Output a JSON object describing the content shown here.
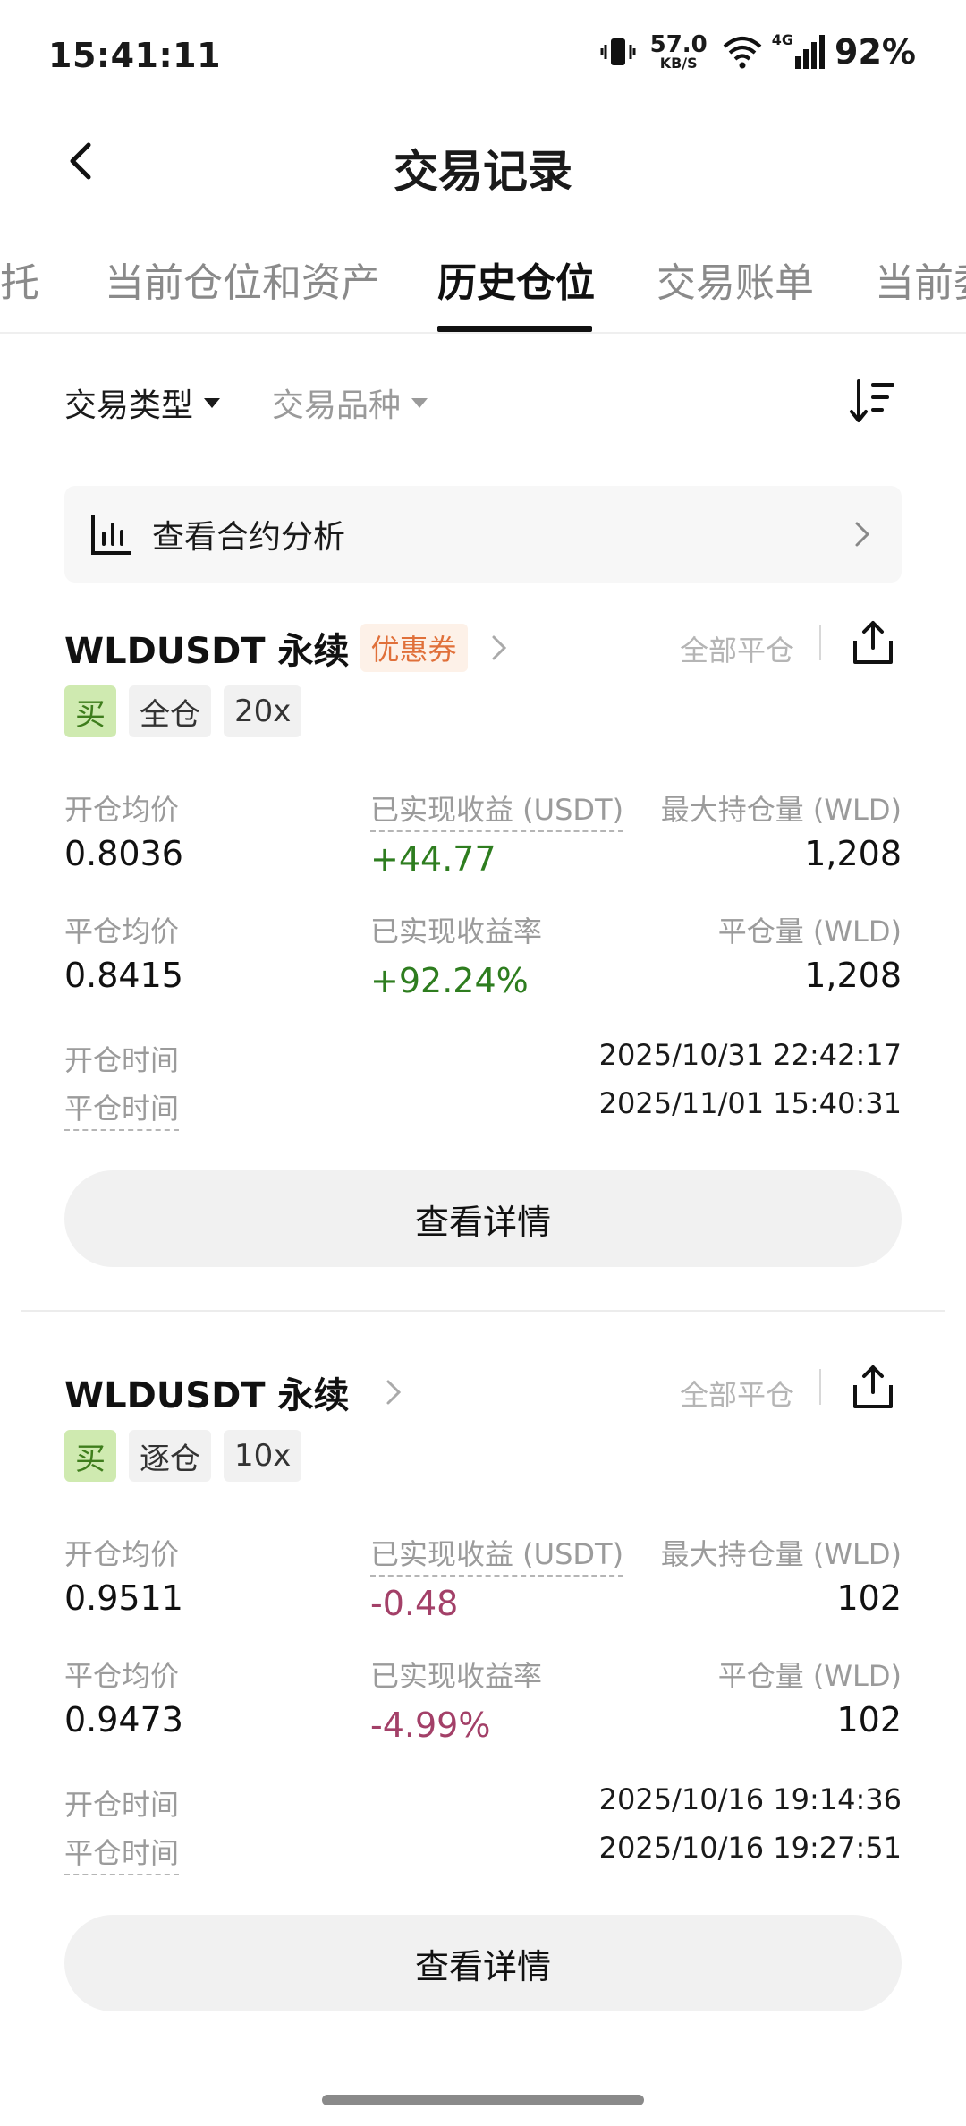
{
  "status_bar": {
    "time": "15:41:11",
    "net_speed": "57.0",
    "net_unit": "KB/S",
    "signal_label": "4G",
    "battery": "92%"
  },
  "header": {
    "title": "交易记录"
  },
  "tabs": [
    {
      "label": "托"
    },
    {
      "label": "当前仓位和资产"
    },
    {
      "label": "历史仓位"
    },
    {
      "label": "交易账单"
    },
    {
      "label": "当前委"
    }
  ],
  "filters": {
    "type": "交易类型",
    "symbol": "交易品种"
  },
  "analysis": {
    "label": "查看合约分析"
  },
  "positions": [
    {
      "symbol": "WLDUSDT 永续",
      "coupon": "优惠券",
      "close_all": "全部平仓",
      "tags": [
        "买",
        "全仓",
        "20x"
      ],
      "labels": {
        "open_avg": "开仓均价",
        "realized_pnl": "已实现收益 (USDT)",
        "max_position": "最大持仓量 (WLD)",
        "close_avg": "平仓均价",
        "realized_rate": "已实现收益率",
        "close_qty": "平仓量 (WLD)",
        "open_time": "开仓时间",
        "close_time": "平仓时间"
      },
      "values": {
        "open_avg": "0.8036",
        "realized_pnl": "+44.77",
        "max_position": "1,208",
        "close_avg": "0.8415",
        "realized_rate": "+92.24%",
        "close_qty": "1,208",
        "open_time": "2025/10/31 22:42:17",
        "close_time": "2025/11/01 15:40:31"
      },
      "detail_button": "查看详情"
    },
    {
      "symbol": "WLDUSDT 永续",
      "close_all": "全部平仓",
      "tags": [
        "买",
        "逐仓",
        "10x"
      ],
      "labels": {
        "open_avg": "开仓均价",
        "realized_pnl": "已实现收益 (USDT)",
        "max_position": "最大持仓量 (WLD)",
        "close_avg": "平仓均价",
        "realized_rate": "已实现收益率",
        "close_qty": "平仓量 (WLD)",
        "open_time": "开仓时间",
        "close_time": "平仓时间"
      },
      "values": {
        "open_avg": "0.9511",
        "realized_pnl": "-0.48",
        "max_position": "102",
        "close_avg": "0.9473",
        "realized_rate": "-4.99%",
        "close_qty": "102",
        "open_time": "2025/10/16 19:14:36",
        "close_time": "2025/10/16 19:27:51"
      },
      "detail_button": "查看详情"
    }
  ],
  "colors": {
    "profit": "#2e7d1f",
    "loss": "#a34068",
    "buy_tag_bg": "#cfeab0",
    "coupon": "#e0703a"
  },
  "icons": [
    "vibrate-icon",
    "wifi-icon",
    "signal-icon",
    "back-icon",
    "sort-icon",
    "bar-chart-icon",
    "chevron-right-icon",
    "share-icon"
  ]
}
